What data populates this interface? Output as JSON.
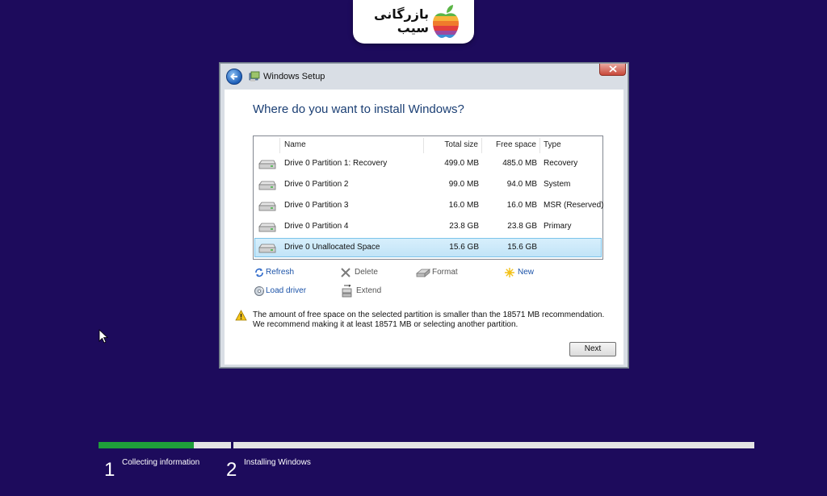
{
  "logo": {
    "line1": "بازرگانی",
    "line2": "سیب"
  },
  "window": {
    "title": "Windows Setup"
  },
  "page": {
    "heading": "Where do you want to install Windows?"
  },
  "table": {
    "columns": [
      "Name",
      "Total size",
      "Free space",
      "Type"
    ],
    "rows": [
      {
        "name": "Drive 0 Partition 1: Recovery",
        "total": "499.0 MB",
        "free": "485.0 MB",
        "type": "Recovery"
      },
      {
        "name": "Drive 0 Partition 2",
        "total": "99.0 MB",
        "free": "94.0 MB",
        "type": "System"
      },
      {
        "name": "Drive 0 Partition 3",
        "total": "16.0 MB",
        "free": "16.0 MB",
        "type": "MSR (Reserved)"
      },
      {
        "name": "Drive 0 Partition 4",
        "total": "23.8 GB",
        "free": "23.8 GB",
        "type": "Primary"
      },
      {
        "name": "Drive 0 Unallocated Space",
        "total": "15.6 GB",
        "free": "15.6 GB",
        "type": ""
      }
    ],
    "selected_index": 4
  },
  "actions": {
    "refresh": "Refresh",
    "delete": "Delete",
    "format": "Format",
    "new": "New",
    "load_driver": "Load driver",
    "extend": "Extend"
  },
  "warning": {
    "line1": "The amount of free space on the selected partition is smaller than the 18571 MB recommendation.",
    "line2": "We recommend making it at least 18571 MB or selecting another partition."
  },
  "buttons": {
    "next": "Next"
  },
  "progress": {
    "steps": [
      {
        "number": "1",
        "label": "Collecting information",
        "fill_fraction": 0.72
      },
      {
        "number": "2",
        "label": "Installing Windows",
        "fill_fraction": 0
      }
    ]
  },
  "colors": {
    "background": "#1d0b5c",
    "progress": "#1f9e3a",
    "selection": "#c2e4f7"
  }
}
